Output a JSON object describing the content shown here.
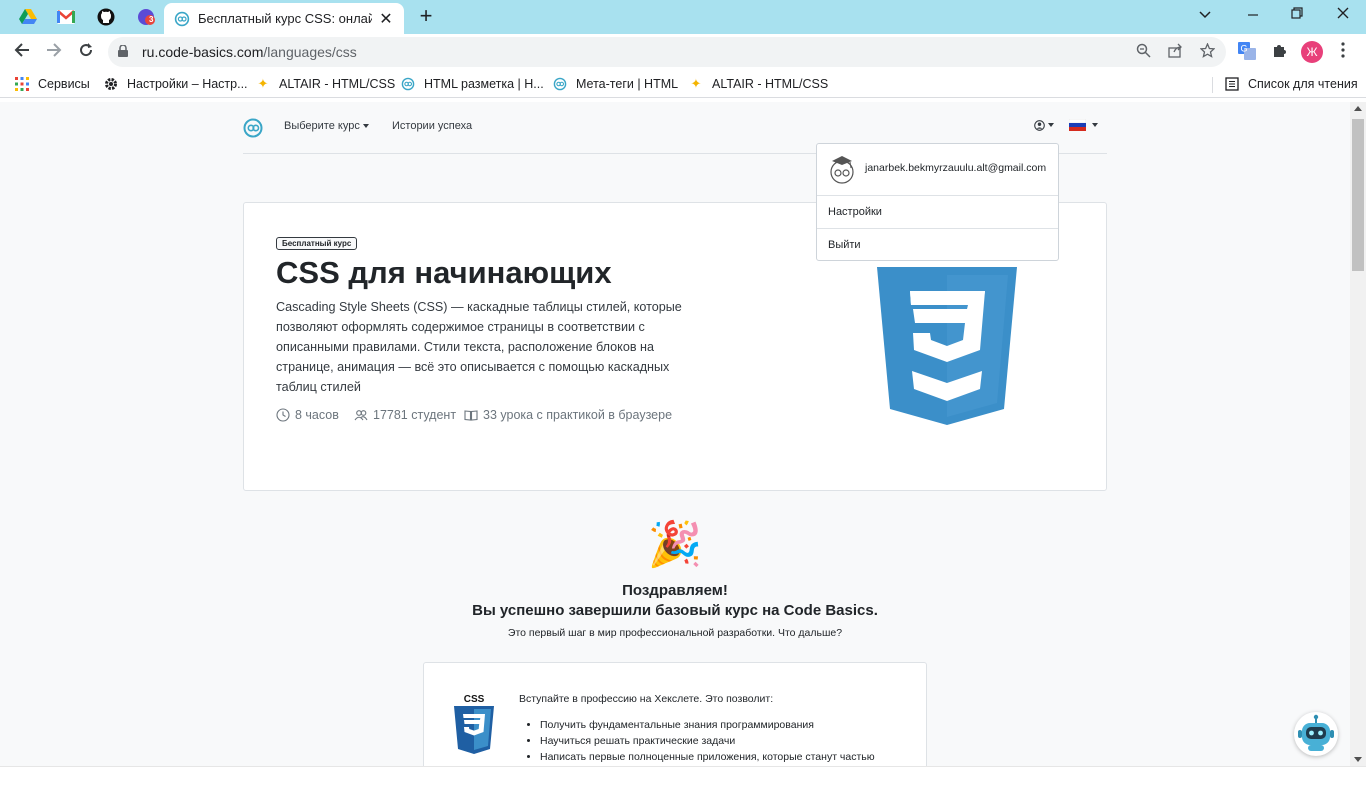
{
  "browser": {
    "tab_title": "Бесплатный курс CSS: онлайн обучение",
    "new_tab": "+",
    "url_host": "ru.code-basics.com",
    "url_path": "/languages/css",
    "profile_initial": "Ж",
    "extension_badge": "3",
    "bookmarks": [
      {
        "label": "Сервисы",
        "icon": "apps-grid-icon"
      },
      {
        "label": "Настройки – Настр...",
        "icon": "gear-icon"
      },
      {
        "label": "ALTAIR - HTML/CSS",
        "icon": "sparkle-icon"
      },
      {
        "label": "HTML разметка | Н...",
        "icon": "code-basics-icon"
      },
      {
        "label": "Мета-теги | HTML",
        "icon": "code-basics-icon"
      },
      {
        "label": "ALTAIR - HTML/CSS",
        "icon": "sparkle-icon"
      }
    ],
    "reading_list": "Список для чтения"
  },
  "site_nav": {
    "choose_course": "Выберите курс",
    "success_stories": "Истории успеха"
  },
  "account_menu": {
    "email": "janarbek.bekmyrzauulu.alt@gmail.com",
    "settings": "Настройки",
    "logout": "Выйти"
  },
  "hero": {
    "badge": "Бесплатный курс",
    "title": "CSS для начинающих",
    "description": "Cascading Style Sheets (CSS) — каскадные таблицы стилей, которые позволяют оформлять содержимое страницы в соответствии с описанными правилами. Стили текста, расположение блоков на странице, анимация — всё это описывается с помощью каскадных таблиц стилей",
    "duration": "8 часов",
    "students": "17781 студент",
    "lessons": "33 урока с практикой в браузере"
  },
  "congrats": {
    "emoji": "🎉",
    "title": "Поздравляем!",
    "subtitle": "Вы успешно завершили базовый курс на Code Basics.",
    "note": "Это первый шаг в мир профессиональной разработки. Что дальше?"
  },
  "cta": {
    "logo_text": "CSS",
    "intro": "Вступайте в профессию на Хекслете. Это позволит:",
    "items": [
      "Получить фундаментальные знания программирования",
      "Научиться решать практические задачи",
      "Написать первые полноценные приложения, которые станут частью"
    ]
  },
  "colors": {
    "tabbar": "#a8e1ef",
    "css_blue": "#3b8fc9",
    "css_dark_blue": "#1f5fa3",
    "brand_teal": "#3aa6c7"
  }
}
